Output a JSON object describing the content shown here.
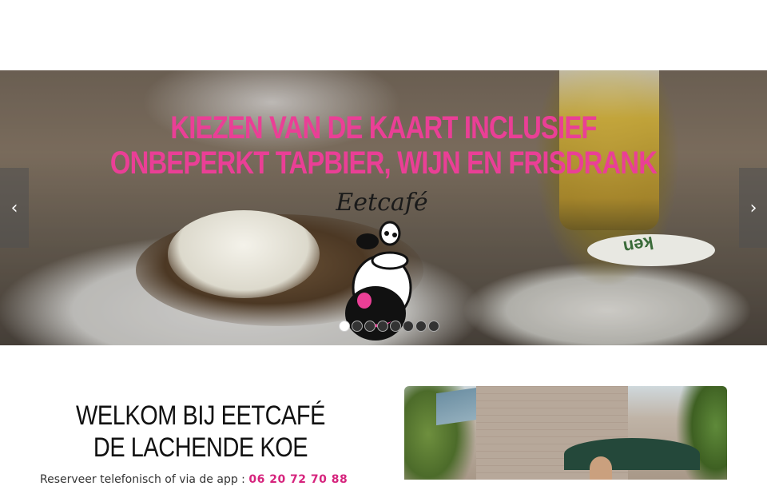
{
  "hero": {
    "heading": "KIEZEN VAN DE KAART INCLUSIEF ONBEPERKT TAPBIER, WIJN EN FRISDRANK",
    "logo_text": "Eetcafé",
    "slides_count": 8,
    "active_slide": 1,
    "prev_arrow": "‹",
    "next_arrow": "›",
    "coaster_text": "ken",
    "heading_color": "#ea3f96"
  },
  "welcome": {
    "title": "WELKOM BIJ EETCAFÉ DE LACHENDE KOE",
    "reserve_text": "Reserveer telefonisch of via de app : ",
    "phone": "06 20 72 70 88",
    "phone_color": "#d6247d"
  }
}
